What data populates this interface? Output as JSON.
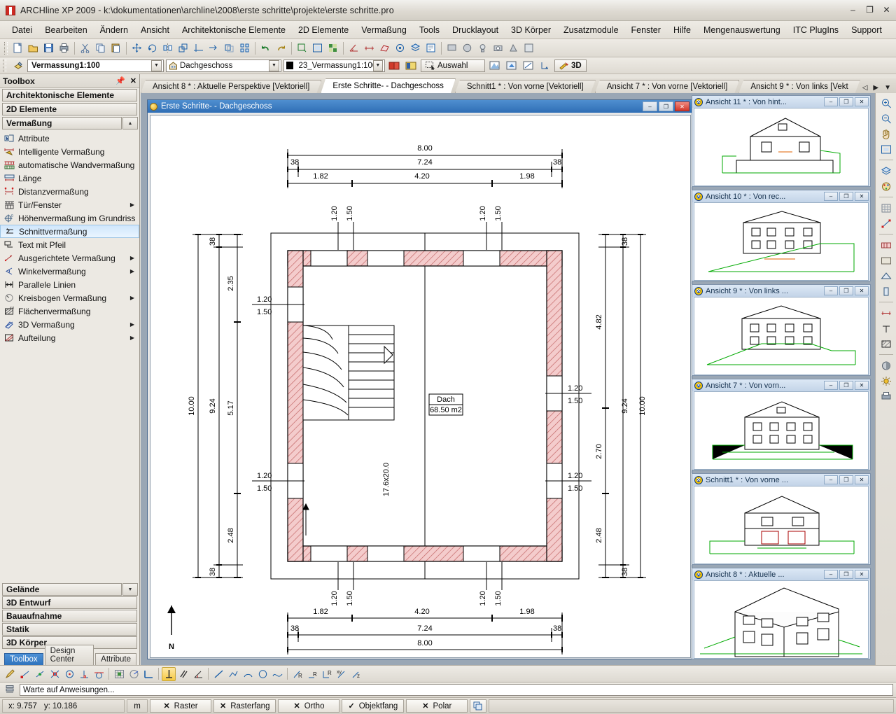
{
  "window": {
    "title": "ARCHline XP 2009 - k:\\dokumentationen\\archline\\2008\\erste schritte\\projekte\\erste schritte.pro",
    "minimize": "–",
    "maximize": "❐",
    "close": "✕"
  },
  "menu": [
    {
      "label": "Datei"
    },
    {
      "label": "Bearbeiten"
    },
    {
      "label": "Ändern"
    },
    {
      "label": "Ansicht"
    },
    {
      "label": "Architektonische Elemente"
    },
    {
      "label": "2D Elemente"
    },
    {
      "label": "Vermaßung"
    },
    {
      "label": "Tools"
    },
    {
      "label": "Drucklayout"
    },
    {
      "label": "3D Körper"
    },
    {
      "label": "Zusatzmodule"
    },
    {
      "label": "Fenster"
    },
    {
      "label": "Hilfe"
    },
    {
      "label": "Mengenauswertung"
    },
    {
      "label": "ITC PlugIns"
    },
    {
      "label": "Support"
    }
  ],
  "toolbar2": {
    "layer_combo": "Vermassung1:100",
    "floor_combo": "Dachgeschoss",
    "pen_combo": "23_Vermassung1:100",
    "select_button": "Auswahl",
    "button_3d": "3D"
  },
  "sidebar": {
    "header": "Toolbox",
    "pin_icon": "pin-icon",
    "close_icon": "close-icon",
    "groups_top": [
      {
        "label": "Architektonische Elemente"
      },
      {
        "label": "2D Elemente"
      }
    ],
    "active_group": "Vermaßung",
    "items": [
      {
        "label": "Attribute",
        "icon": "attribute-icon",
        "submenu": false,
        "selected": false
      },
      {
        "label": "Intelligente Vermaßung",
        "icon": "smart-dimension-icon",
        "submenu": false,
        "selected": false
      },
      {
        "label": "automatische Wandvermaßung",
        "icon": "auto-wall-dimension-icon",
        "submenu": false,
        "selected": false
      },
      {
        "label": "Länge",
        "icon": "length-icon",
        "submenu": false,
        "selected": false
      },
      {
        "label": "Distanzvermaßung",
        "icon": "distance-dimension-icon",
        "submenu": false,
        "selected": false
      },
      {
        "label": "Tür/Fenster",
        "icon": "door-window-icon",
        "submenu": true,
        "selected": false
      },
      {
        "label": "Höhenvermaßung im Grundriss",
        "icon": "elevation-dimension-icon",
        "submenu": false,
        "selected": false
      },
      {
        "label": "Schnittvermaßung",
        "icon": "section-dimension-icon",
        "submenu": false,
        "selected": true
      },
      {
        "label": "Text mit Pfeil",
        "icon": "text-leader-icon",
        "submenu": false,
        "selected": false
      },
      {
        "label": "Ausgerichtete Vermaßung",
        "icon": "aligned-dimension-icon",
        "submenu": true,
        "selected": false
      },
      {
        "label": "Winkelvermaßung",
        "icon": "angular-dimension-icon",
        "submenu": true,
        "selected": false
      },
      {
        "label": "Parallele Linien",
        "icon": "parallel-lines-icon",
        "submenu": false,
        "selected": false
      },
      {
        "label": "Kreisbogen Vermaßung",
        "icon": "arc-dimension-icon",
        "submenu": true,
        "selected": false
      },
      {
        "label": "Flächenvermaßung",
        "icon": "area-dimension-icon",
        "submenu": false,
        "selected": false
      },
      {
        "label": "3D Vermaßung",
        "icon": "dimension-3d-icon",
        "submenu": true,
        "selected": false
      },
      {
        "label": "Aufteilung",
        "icon": "division-icon",
        "submenu": true,
        "selected": false
      }
    ],
    "groups_bottom": [
      {
        "label": "Gelände",
        "has_dropdown": true
      },
      {
        "label": "3D Entwurf",
        "has_dropdown": false
      },
      {
        "label": "Bauaufnahme",
        "has_dropdown": false
      },
      {
        "label": "Statik",
        "has_dropdown": false
      },
      {
        "label": "3D Körper",
        "has_dropdown": false
      }
    ],
    "tabs": [
      {
        "label": "Toolbox",
        "active": true
      },
      {
        "label": "Design Center",
        "active": false
      },
      {
        "label": "Attribute",
        "active": false
      }
    ]
  },
  "doc_tabs": [
    {
      "label": "Ansicht 8 * : Aktuelle Perspektive [Vektoriell]",
      "active": false
    },
    {
      "label": "Erste Schritte-  - Dachgeschoss",
      "active": true
    },
    {
      "label": "Schnitt1 * : Von vorne [Vektoriell]",
      "active": false
    },
    {
      "label": "Ansicht 7 * : Von vorne [Vektoriell]",
      "active": false
    },
    {
      "label": "Ansicht 9 * : Von links [Vekt",
      "active": false
    }
  ],
  "tabnav": {
    "prev": "◁",
    "next": "▶",
    "list": "▼",
    "close": "✕"
  },
  "mdi": {
    "title": "Erste Schritte-  - Dachgeschoss",
    "minimize": "–",
    "maximize": "❐",
    "close": "✕"
  },
  "drawing": {
    "room_label": "Dach",
    "room_area": "68.50 m2",
    "north_label": "N",
    "top_dims": {
      "overall": "8.00",
      "inner": "7.24",
      "wall_left": "38",
      "wall_right": "38",
      "segments": [
        "1.82",
        "4.20",
        "1.98"
      ]
    },
    "bottom_dims": {
      "overall": "8.00",
      "inner": "7.24",
      "wall_left": "38",
      "wall_right": "38",
      "segments": [
        "1.82",
        "4.20",
        "1.98"
      ]
    },
    "left_dims": {
      "overall": "10.00",
      "inner": "9.24",
      "wall_top": "38",
      "wall_bottom": "38",
      "segments": [
        "2.35",
        "5.17",
        "2.48"
      ]
    },
    "right_dims": {
      "overall": "10.00",
      "inner": "9.24",
      "wall_top": "38",
      "wall_bottom": "38",
      "segments": [
        "4.82",
        "2.70",
        "2.48"
      ]
    },
    "openings": [
      {
        "width": "1.20",
        "height": "1.50"
      },
      {
        "width": "1.20",
        "height": "1.50"
      },
      {
        "width": "1.20",
        "height": "1.50"
      },
      {
        "width": "1.20",
        "height": "1.50"
      },
      {
        "width": "1.20",
        "height": "1.50"
      },
      {
        "width": "1.20",
        "height": "1.50"
      },
      {
        "width": "1.20",
        "height": "1.50"
      },
      {
        "width": "1.20",
        "height": "1.50"
      }
    ],
    "stair_label": "17.6x20.0"
  },
  "thumbnails": [
    {
      "title": "Ansicht 11 * : Von hint...",
      "view": "rear"
    },
    {
      "title": "Ansicht 10 * : Von rec...",
      "view": "right"
    },
    {
      "title": "Ansicht 9 * : Von links ...",
      "view": "left"
    },
    {
      "title": "Ansicht 7 * : Von vorn...",
      "view": "front"
    },
    {
      "title": "Schnitt1 * : Von vorne ...",
      "view": "section"
    },
    {
      "title": "Ansicht 8 * : Aktuelle ...",
      "view": "perspective"
    }
  ],
  "thumb_buttons": {
    "minimize": "–",
    "maximize": "❐",
    "close": "✕"
  },
  "statusbar": {
    "prompt": "Warte auf Anweisungen...",
    "prompt_icon": "command-prompt-icon",
    "coord_x": "x: 9.757",
    "coord_y": "y: 10.186",
    "unit": "m",
    "toggles": [
      {
        "mark": "✕",
        "label": "Raster"
      },
      {
        "mark": "✕",
        "label": "Rasterfang"
      },
      {
        "mark": "✕",
        "label": "Ortho"
      },
      {
        "mark": "✓",
        "label": "Objektfang"
      },
      {
        "mark": "✕",
        "label": "Polar"
      }
    ]
  },
  "colors": {
    "accent": "#2f6eb5",
    "wall_hatch": "#e8a0a0",
    "title_text": "#1b1b1b",
    "terrain_green": "#00a000",
    "selection": "#cfe6fb"
  }
}
